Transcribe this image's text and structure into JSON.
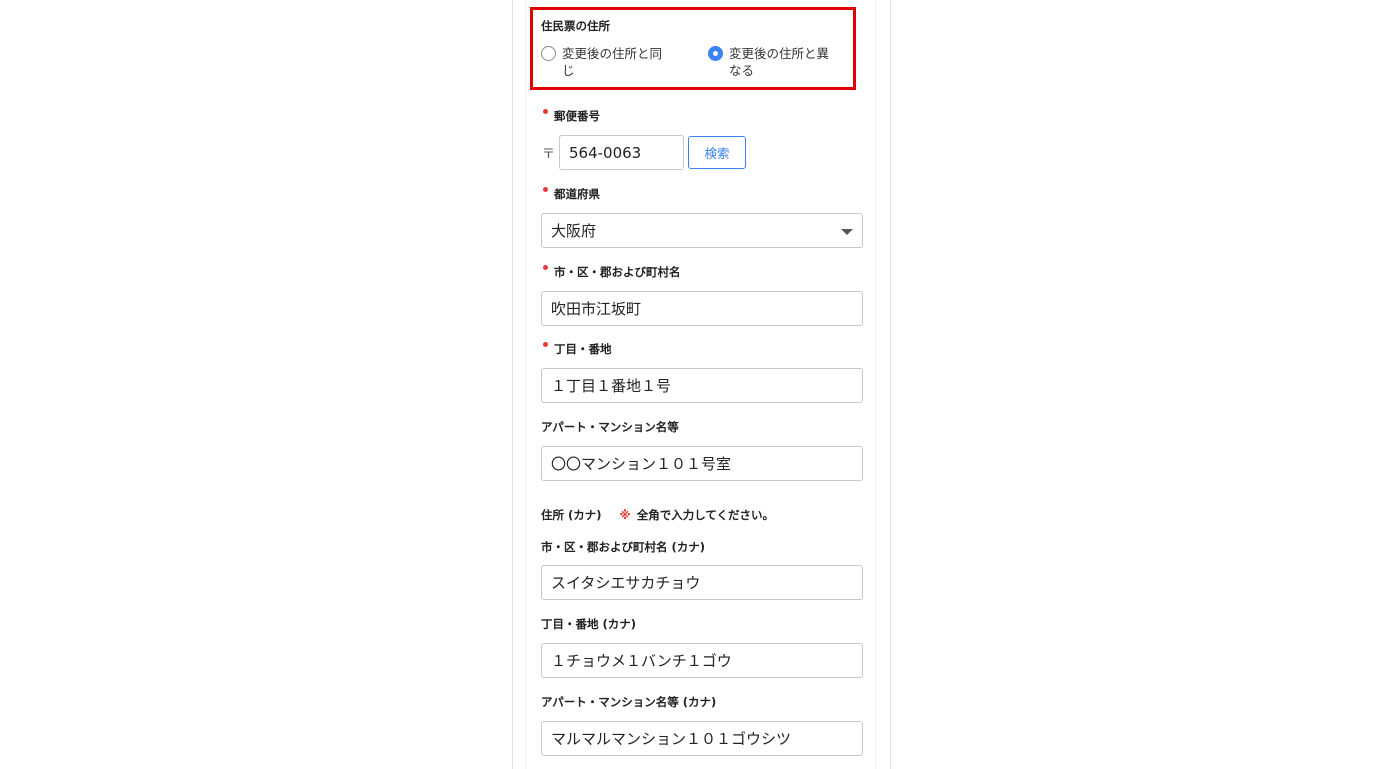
{
  "residence_address": {
    "label": "住民票の住所",
    "options": [
      {
        "label": "変更後の住所と同じ",
        "selected": false
      },
      {
        "label": "変更後の住所と異なる",
        "selected": true
      }
    ]
  },
  "postal_code": {
    "label": "郵便番号",
    "prefix": "〒",
    "value": "564-0063",
    "search_button": "検索",
    "required": true
  },
  "prefecture": {
    "label": "都道府県",
    "value": "大阪府",
    "required": true
  },
  "city": {
    "label": "市・区・郡および町村名",
    "value": "吹田市江坂町",
    "required": true
  },
  "block": {
    "label": "丁目・番地",
    "value": "１丁目１番地１号",
    "required": true
  },
  "building": {
    "label": "アパート・マンション名等",
    "value": "〇〇マンション１０１号室",
    "required": false
  },
  "kana_section": {
    "label": "住所 (カナ)",
    "note_mark": "※",
    "note": "全角で入力してください。"
  },
  "city_kana": {
    "label": "市・区・郡および町村名 (カナ)",
    "value": "スイタシエサカチョウ"
  },
  "block_kana": {
    "label": "丁目・番地 (カナ)",
    "value": "１チョウメ１バンチ１ゴウ"
  },
  "building_kana": {
    "label": "アパート・マンション名等 (カナ)",
    "value": "マルマルマンション１０１ゴウシツ"
  },
  "colors": {
    "highlight": "#e00000",
    "accent": "#3b82f6",
    "required": "#e53935"
  }
}
